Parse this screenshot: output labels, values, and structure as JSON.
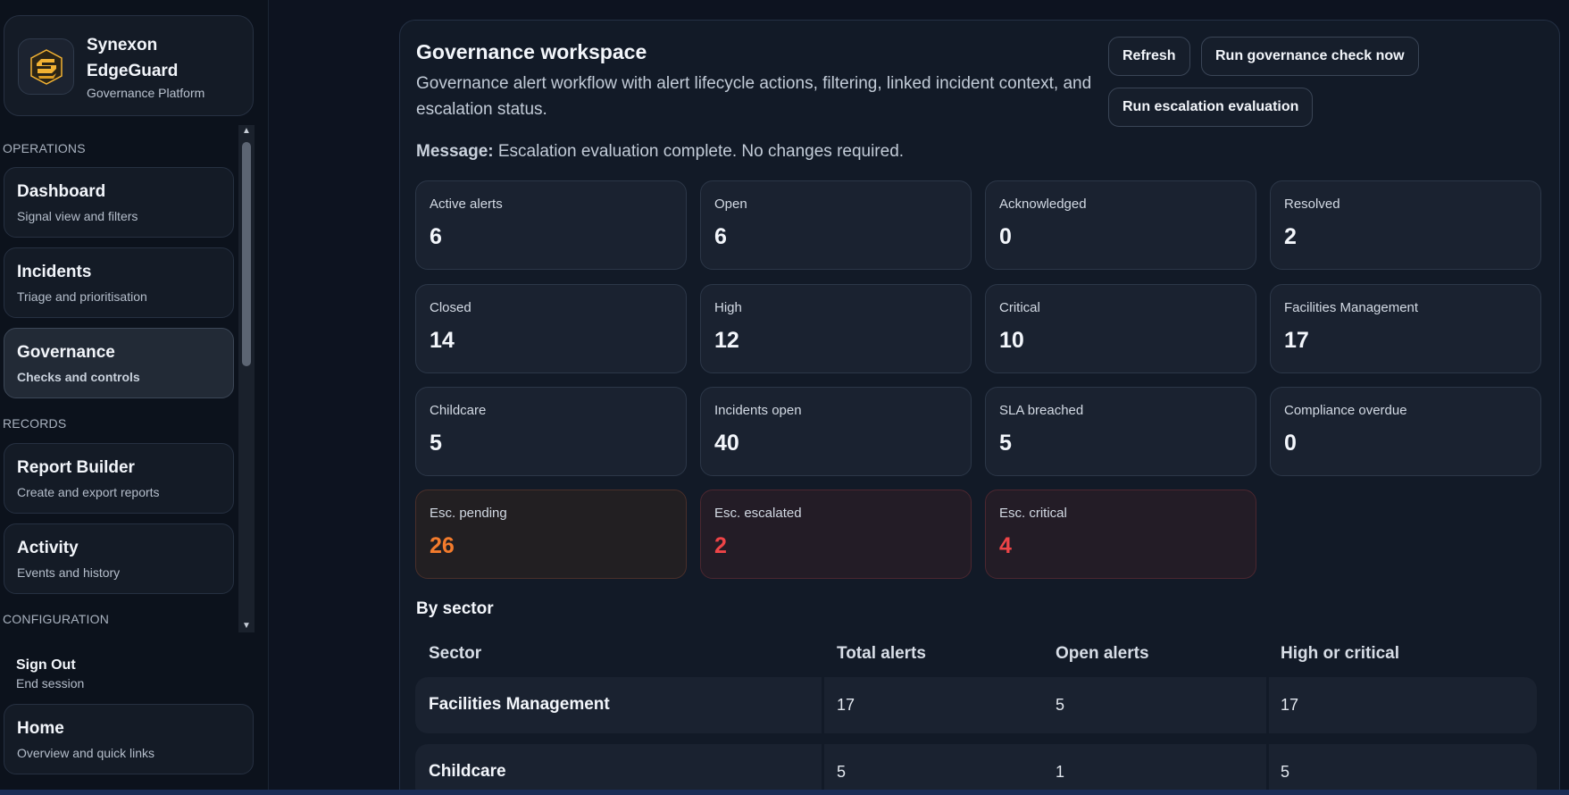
{
  "brand": {
    "name": "Synexon EdgeGuard",
    "subtitle": "Governance Platform",
    "logo_icon": "synexon-s-logo",
    "accent": "#f2b233"
  },
  "sidebar": {
    "sections": {
      "operations": "OPERATIONS",
      "records": "RECORDS",
      "configuration": "CONFIGURATION"
    },
    "items": [
      {
        "title": "Dashboard",
        "subtitle": "Signal view and filters",
        "active": false
      },
      {
        "title": "Incidents",
        "subtitle": "Triage and prioritisation",
        "active": false
      },
      {
        "title": "Governance",
        "subtitle": "Checks and controls",
        "active": true
      },
      {
        "title": "Report Builder",
        "subtitle": "Create and export reports",
        "active": false
      },
      {
        "title": "Activity",
        "subtitle": "Events and history",
        "active": false
      }
    ],
    "sign_out": {
      "title": "Sign Out",
      "subtitle": "End session"
    },
    "home": {
      "title": "Home",
      "subtitle": "Overview and quick links"
    }
  },
  "workspace": {
    "title": "Governance workspace",
    "description": "Governance alert workflow with alert lifecycle actions, filtering, linked incident context, and escalation status.",
    "buttons": {
      "refresh": "Refresh",
      "run_check": "Run governance check now",
      "run_escalation": "Run escalation evaluation"
    },
    "message_label": "Message:",
    "message_text": " Escalation evaluation complete. No changes required."
  },
  "stats": [
    {
      "label": "Active alerts",
      "value": "6"
    },
    {
      "label": "Open",
      "value": "6"
    },
    {
      "label": "Acknowledged",
      "value": "0"
    },
    {
      "label": "Resolved",
      "value": "2"
    },
    {
      "label": "Closed",
      "value": "14"
    },
    {
      "label": "High",
      "value": "12"
    },
    {
      "label": "Critical",
      "value": "10"
    },
    {
      "label": "Facilities Management",
      "value": "17"
    },
    {
      "label": "Childcare",
      "value": "5"
    },
    {
      "label": "Incidents open",
      "value": "40"
    },
    {
      "label": "SLA breached",
      "value": "5"
    },
    {
      "label": "Compliance overdue",
      "value": "0"
    },
    {
      "label": "Esc. pending",
      "value": "26"
    },
    {
      "label": "Esc. escalated",
      "value": "2"
    },
    {
      "label": "Esc. critical",
      "value": "4"
    }
  ],
  "sector_table": {
    "title": "By sector",
    "headers": [
      "Sector",
      "Total alerts",
      "Open alerts",
      "High or critical"
    ],
    "rows": [
      [
        "Facilities Management",
        "17",
        "5",
        "17"
      ],
      [
        "Childcare",
        "5",
        "1",
        "5"
      ]
    ]
  },
  "colors": {
    "warning": "#f47b2c",
    "danger": "#ee4447"
  }
}
